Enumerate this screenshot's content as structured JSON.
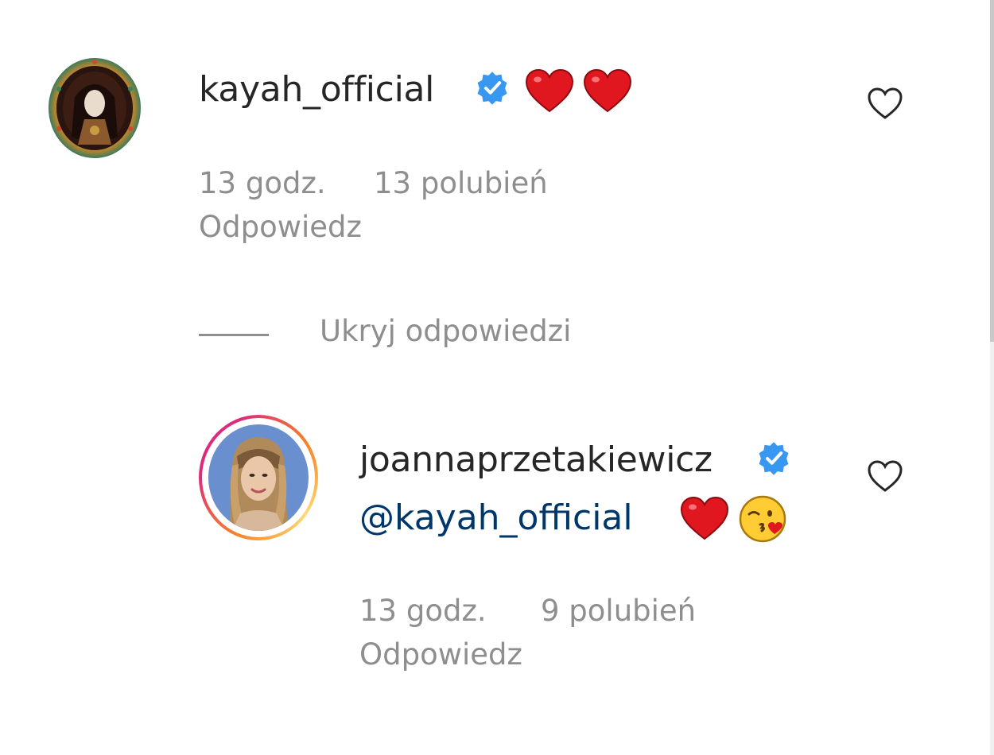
{
  "comment": {
    "username": "kayah_official",
    "verified": true,
    "text_emojis": [
      "red-heart",
      "red-heart"
    ],
    "time": "13 godz.",
    "likes": "13 polubień",
    "reply_label": "Odpowiedz",
    "like_icon": "heart-outline-icon"
  },
  "hide_replies_label": "Ukryj odpowiedzi",
  "reply": {
    "username": "joannaprzetakiewicz",
    "verified": true,
    "mention": "@kayah_official",
    "text_emojis": [
      "red-heart",
      "kissing-face"
    ],
    "time": "13 godz.",
    "likes": "9 polubień",
    "reply_label": "Odpowiedz",
    "like_icon": "heart-outline-icon",
    "has_story_ring": true
  },
  "colors": {
    "text": "#262626",
    "secondary": "#8e8e8e",
    "verified_blue": "#3897f0",
    "mention": "#00376b",
    "heart_red": "#e0171e"
  }
}
